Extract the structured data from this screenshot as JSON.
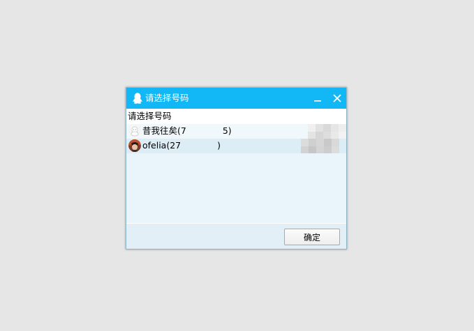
{
  "dialog": {
    "title": "请选择号码",
    "prompt": "请选择号码",
    "title_bar_color": "#12b7f5",
    "minimize_icon": "minimize-icon",
    "close_icon": "close-icon"
  },
  "accounts": [
    {
      "label_visible": "昔我往矣(7",
      "label_tail": "5)",
      "avatar_icon": "default-avatar-icon"
    },
    {
      "label_visible": "ofelia(27",
      "label_tail": ")",
      "avatar_icon": "photo-avatar-icon"
    }
  ],
  "footer": {
    "ok_label": "确定"
  }
}
